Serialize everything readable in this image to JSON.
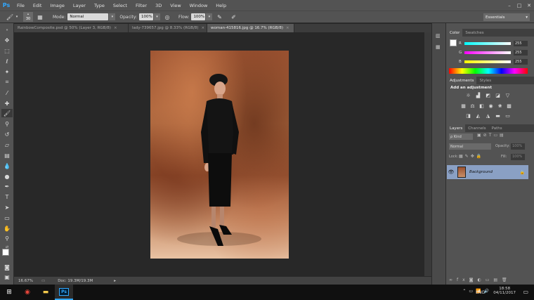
{
  "app": {
    "logo": "Ps",
    "accent": "#31a8ff"
  },
  "menu": [
    "File",
    "Edit",
    "Image",
    "Layer",
    "Type",
    "Select",
    "Filter",
    "3D",
    "View",
    "Window",
    "Help"
  ],
  "window_controls": [
    "–",
    "□",
    "✕"
  ],
  "options": {
    "brush_size": "30",
    "mode_label": "Mode:",
    "mode_value": "Normal",
    "opacity_label": "Opacity:",
    "opacity_value": "100%",
    "flow_label": "Flow:",
    "flow_value": "100%",
    "workspace": "Essentials"
  },
  "tabs": [
    {
      "label": "RainbowComposite.psd @ 50% (Layer 3, RGB/8)",
      "close": "×"
    },
    {
      "label": "lady-739657.jpg @ 8.33% (RGB/8)",
      "close": "×"
    },
    {
      "label": "woman-415816.jpg @ 16.7% (RGB/8)",
      "close": "×"
    }
  ],
  "panels": {
    "color_tabs": [
      "Color",
      "Swatches"
    ],
    "sliders": [
      {
        "label": "R",
        "value": "255",
        "gradient": "linear-gradient(90deg,#0ff,#fff)"
      },
      {
        "label": "G",
        "value": "255",
        "gradient": "linear-gradient(90deg,#f0f,#fff)"
      },
      {
        "label": "B",
        "value": "255",
        "gradient": "linear-gradient(90deg,#ff0,#fff)"
      }
    ],
    "adjust_tabs": [
      "Adjustments",
      "Styles"
    ],
    "adjust_title": "Add an adjustment",
    "layers_tabs": [
      "Layers",
      "Channels",
      "Paths"
    ],
    "kind_label": "ρ Kind",
    "blend_mode": "Normal",
    "opacity_label": "Opacity:",
    "opacity_value": "100%",
    "lock_label": "Lock:",
    "fill_label": "Fill:",
    "fill_value": "100%",
    "layer_name": "Background"
  },
  "status": {
    "zoom": "16.67%",
    "doc": "Doc: 19.3M/19.3M"
  },
  "taskbar": {
    "lang": "ENG",
    "time": "18:58",
    "date": "04/11/2017"
  }
}
